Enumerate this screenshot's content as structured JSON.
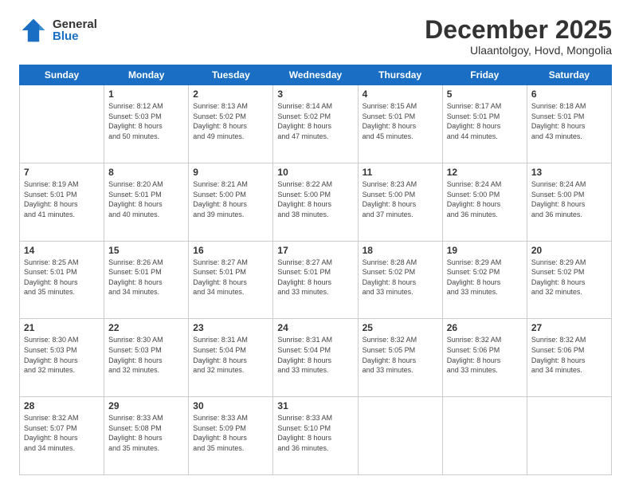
{
  "logo": {
    "general": "General",
    "blue": "Blue"
  },
  "header": {
    "month": "December 2025",
    "location": "Ulaantolgoy, Hovd, Mongolia"
  },
  "weekdays": [
    "Sunday",
    "Monday",
    "Tuesday",
    "Wednesday",
    "Thursday",
    "Friday",
    "Saturday"
  ],
  "weeks": [
    [
      {
        "day": "",
        "info": ""
      },
      {
        "day": "1",
        "info": "Sunrise: 8:12 AM\nSunset: 5:03 PM\nDaylight: 8 hours\nand 50 minutes."
      },
      {
        "day": "2",
        "info": "Sunrise: 8:13 AM\nSunset: 5:02 PM\nDaylight: 8 hours\nand 49 minutes."
      },
      {
        "day": "3",
        "info": "Sunrise: 8:14 AM\nSunset: 5:02 PM\nDaylight: 8 hours\nand 47 minutes."
      },
      {
        "day": "4",
        "info": "Sunrise: 8:15 AM\nSunset: 5:01 PM\nDaylight: 8 hours\nand 45 minutes."
      },
      {
        "day": "5",
        "info": "Sunrise: 8:17 AM\nSunset: 5:01 PM\nDaylight: 8 hours\nand 44 minutes."
      },
      {
        "day": "6",
        "info": "Sunrise: 8:18 AM\nSunset: 5:01 PM\nDaylight: 8 hours\nand 43 minutes."
      }
    ],
    [
      {
        "day": "7",
        "info": "Sunrise: 8:19 AM\nSunset: 5:01 PM\nDaylight: 8 hours\nand 41 minutes."
      },
      {
        "day": "8",
        "info": "Sunrise: 8:20 AM\nSunset: 5:01 PM\nDaylight: 8 hours\nand 40 minutes."
      },
      {
        "day": "9",
        "info": "Sunrise: 8:21 AM\nSunset: 5:00 PM\nDaylight: 8 hours\nand 39 minutes."
      },
      {
        "day": "10",
        "info": "Sunrise: 8:22 AM\nSunset: 5:00 PM\nDaylight: 8 hours\nand 38 minutes."
      },
      {
        "day": "11",
        "info": "Sunrise: 8:23 AM\nSunset: 5:00 PM\nDaylight: 8 hours\nand 37 minutes."
      },
      {
        "day": "12",
        "info": "Sunrise: 8:24 AM\nSunset: 5:00 PM\nDaylight: 8 hours\nand 36 minutes."
      },
      {
        "day": "13",
        "info": "Sunrise: 8:24 AM\nSunset: 5:00 PM\nDaylight: 8 hours\nand 36 minutes."
      }
    ],
    [
      {
        "day": "14",
        "info": "Sunrise: 8:25 AM\nSunset: 5:01 PM\nDaylight: 8 hours\nand 35 minutes."
      },
      {
        "day": "15",
        "info": "Sunrise: 8:26 AM\nSunset: 5:01 PM\nDaylight: 8 hours\nand 34 minutes."
      },
      {
        "day": "16",
        "info": "Sunrise: 8:27 AM\nSunset: 5:01 PM\nDaylight: 8 hours\nand 34 minutes."
      },
      {
        "day": "17",
        "info": "Sunrise: 8:27 AM\nSunset: 5:01 PM\nDaylight: 8 hours\nand 33 minutes."
      },
      {
        "day": "18",
        "info": "Sunrise: 8:28 AM\nSunset: 5:02 PM\nDaylight: 8 hours\nand 33 minutes."
      },
      {
        "day": "19",
        "info": "Sunrise: 8:29 AM\nSunset: 5:02 PM\nDaylight: 8 hours\nand 33 minutes."
      },
      {
        "day": "20",
        "info": "Sunrise: 8:29 AM\nSunset: 5:02 PM\nDaylight: 8 hours\nand 32 minutes."
      }
    ],
    [
      {
        "day": "21",
        "info": "Sunrise: 8:30 AM\nSunset: 5:03 PM\nDaylight: 8 hours\nand 32 minutes."
      },
      {
        "day": "22",
        "info": "Sunrise: 8:30 AM\nSunset: 5:03 PM\nDaylight: 8 hours\nand 32 minutes."
      },
      {
        "day": "23",
        "info": "Sunrise: 8:31 AM\nSunset: 5:04 PM\nDaylight: 8 hours\nand 32 minutes."
      },
      {
        "day": "24",
        "info": "Sunrise: 8:31 AM\nSunset: 5:04 PM\nDaylight: 8 hours\nand 33 minutes."
      },
      {
        "day": "25",
        "info": "Sunrise: 8:32 AM\nSunset: 5:05 PM\nDaylight: 8 hours\nand 33 minutes."
      },
      {
        "day": "26",
        "info": "Sunrise: 8:32 AM\nSunset: 5:06 PM\nDaylight: 8 hours\nand 33 minutes."
      },
      {
        "day": "27",
        "info": "Sunrise: 8:32 AM\nSunset: 5:06 PM\nDaylight: 8 hours\nand 34 minutes."
      }
    ],
    [
      {
        "day": "28",
        "info": "Sunrise: 8:32 AM\nSunset: 5:07 PM\nDaylight: 8 hours\nand 34 minutes."
      },
      {
        "day": "29",
        "info": "Sunrise: 8:33 AM\nSunset: 5:08 PM\nDaylight: 8 hours\nand 35 minutes."
      },
      {
        "day": "30",
        "info": "Sunrise: 8:33 AM\nSunset: 5:09 PM\nDaylight: 8 hours\nand 35 minutes."
      },
      {
        "day": "31",
        "info": "Sunrise: 8:33 AM\nSunset: 5:10 PM\nDaylight: 8 hours\nand 36 minutes."
      },
      {
        "day": "",
        "info": ""
      },
      {
        "day": "",
        "info": ""
      },
      {
        "day": "",
        "info": ""
      }
    ]
  ]
}
